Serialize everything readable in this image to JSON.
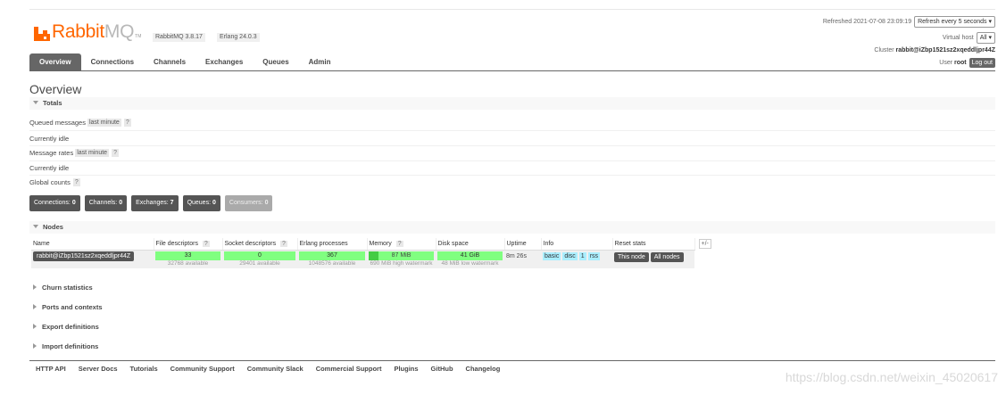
{
  "header": {
    "logo_rabbit": "Rabbit",
    "logo_mq": "MQ",
    "logo_tm": "TM",
    "rabbitmq_version": "RabbitMQ 3.8.17",
    "erlang_version": "Erlang 24.0.3",
    "refreshed_label": "Refreshed 2021-07-08 23:09:19",
    "refresh_select": "Refresh every 5 seconds",
    "virtual_host_label": "Virtual host",
    "virtual_host_select": "All",
    "cluster_label": "Cluster",
    "cluster_name": "rabbit@iZbp1521sz2xqeddljpr44Z",
    "user_label": "User",
    "user_name": "root",
    "logout_label": "Log out"
  },
  "tabs": [
    "Overview",
    "Connections",
    "Channels",
    "Exchanges",
    "Queues",
    "Admin"
  ],
  "page_title": "Overview",
  "totals": {
    "section_label": "Totals",
    "queued_messages_label": "Queued messages",
    "queued_messages_range": "last minute",
    "help": "?",
    "currently_idle_1": "Currently idle",
    "message_rates_label": "Message rates",
    "message_rates_range": "last minute",
    "currently_idle_2": "Currently idle",
    "global_counts_label": "Global counts"
  },
  "counts": [
    {
      "label": "Connections:",
      "value": "0"
    },
    {
      "label": "Channels:",
      "value": "0"
    },
    {
      "label": "Exchanges:",
      "value": "7"
    },
    {
      "label": "Queues:",
      "value": "0"
    },
    {
      "label": "Consumers:",
      "value": "0"
    }
  ],
  "nodes": {
    "section_label": "Nodes",
    "columns": [
      "Name",
      "File descriptors",
      "Socket descriptors",
      "Erlang processes",
      "Memory",
      "Disk space",
      "Uptime",
      "Info",
      "Reset stats"
    ],
    "help": "?",
    "plus_minus": "+/-",
    "row": {
      "name": "rabbit@iZbp1521sz2xqeddljpr44Z",
      "fd_value": "33",
      "fd_available": "32768 available",
      "sd_value": "0",
      "sd_available": "29401 available",
      "ep_value": "367",
      "ep_available": "1048576 available",
      "memory_value": "87 MiB",
      "memory_fraction": 0.15,
      "memory_watermark": "690 MiB high watermark",
      "disk_value": "41 GiB",
      "disk_watermark": "48 MiB low watermark",
      "uptime": "8m 26s",
      "info_tags": [
        "basic",
        "disc",
        "1",
        "rss"
      ],
      "reset_this": "This node",
      "reset_all": "All nodes"
    }
  },
  "collapsed_sections": [
    "Churn statistics",
    "Ports and contexts",
    "Export definitions",
    "Import definitions"
  ],
  "footer_links": [
    "HTTP API",
    "Server Docs",
    "Tutorials",
    "Community Support",
    "Community Slack",
    "Commercial Support",
    "Plugins",
    "GitHub",
    "Changelog"
  ],
  "watermark": "https://blog.csdn.net/weixin_45020617"
}
